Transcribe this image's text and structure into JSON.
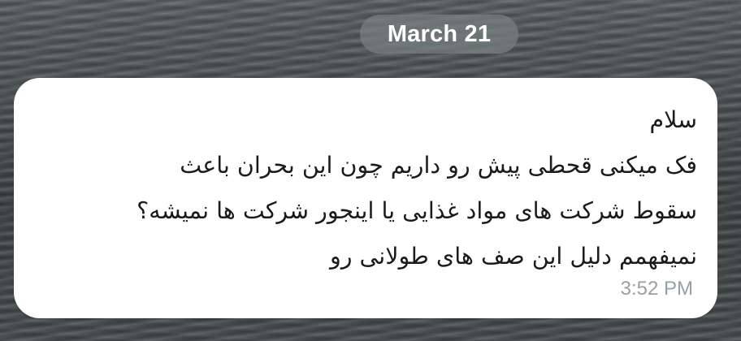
{
  "date_separator": {
    "label": "March 21"
  },
  "message": {
    "lines": [
      "سلام",
      "فک میکنی قحطی پیش رو داریم چون این بحران باعث",
      "سقوط شرکت های مواد غذایی یا اینجور شرکت ها نمیشه؟",
      "نمیفهمم دلیل این صف های طولانی رو"
    ],
    "time": "3:52 PM",
    "bubble_color": "#ffffff",
    "text_color": "#1b1b1b",
    "time_color": "#9a9fa3"
  }
}
